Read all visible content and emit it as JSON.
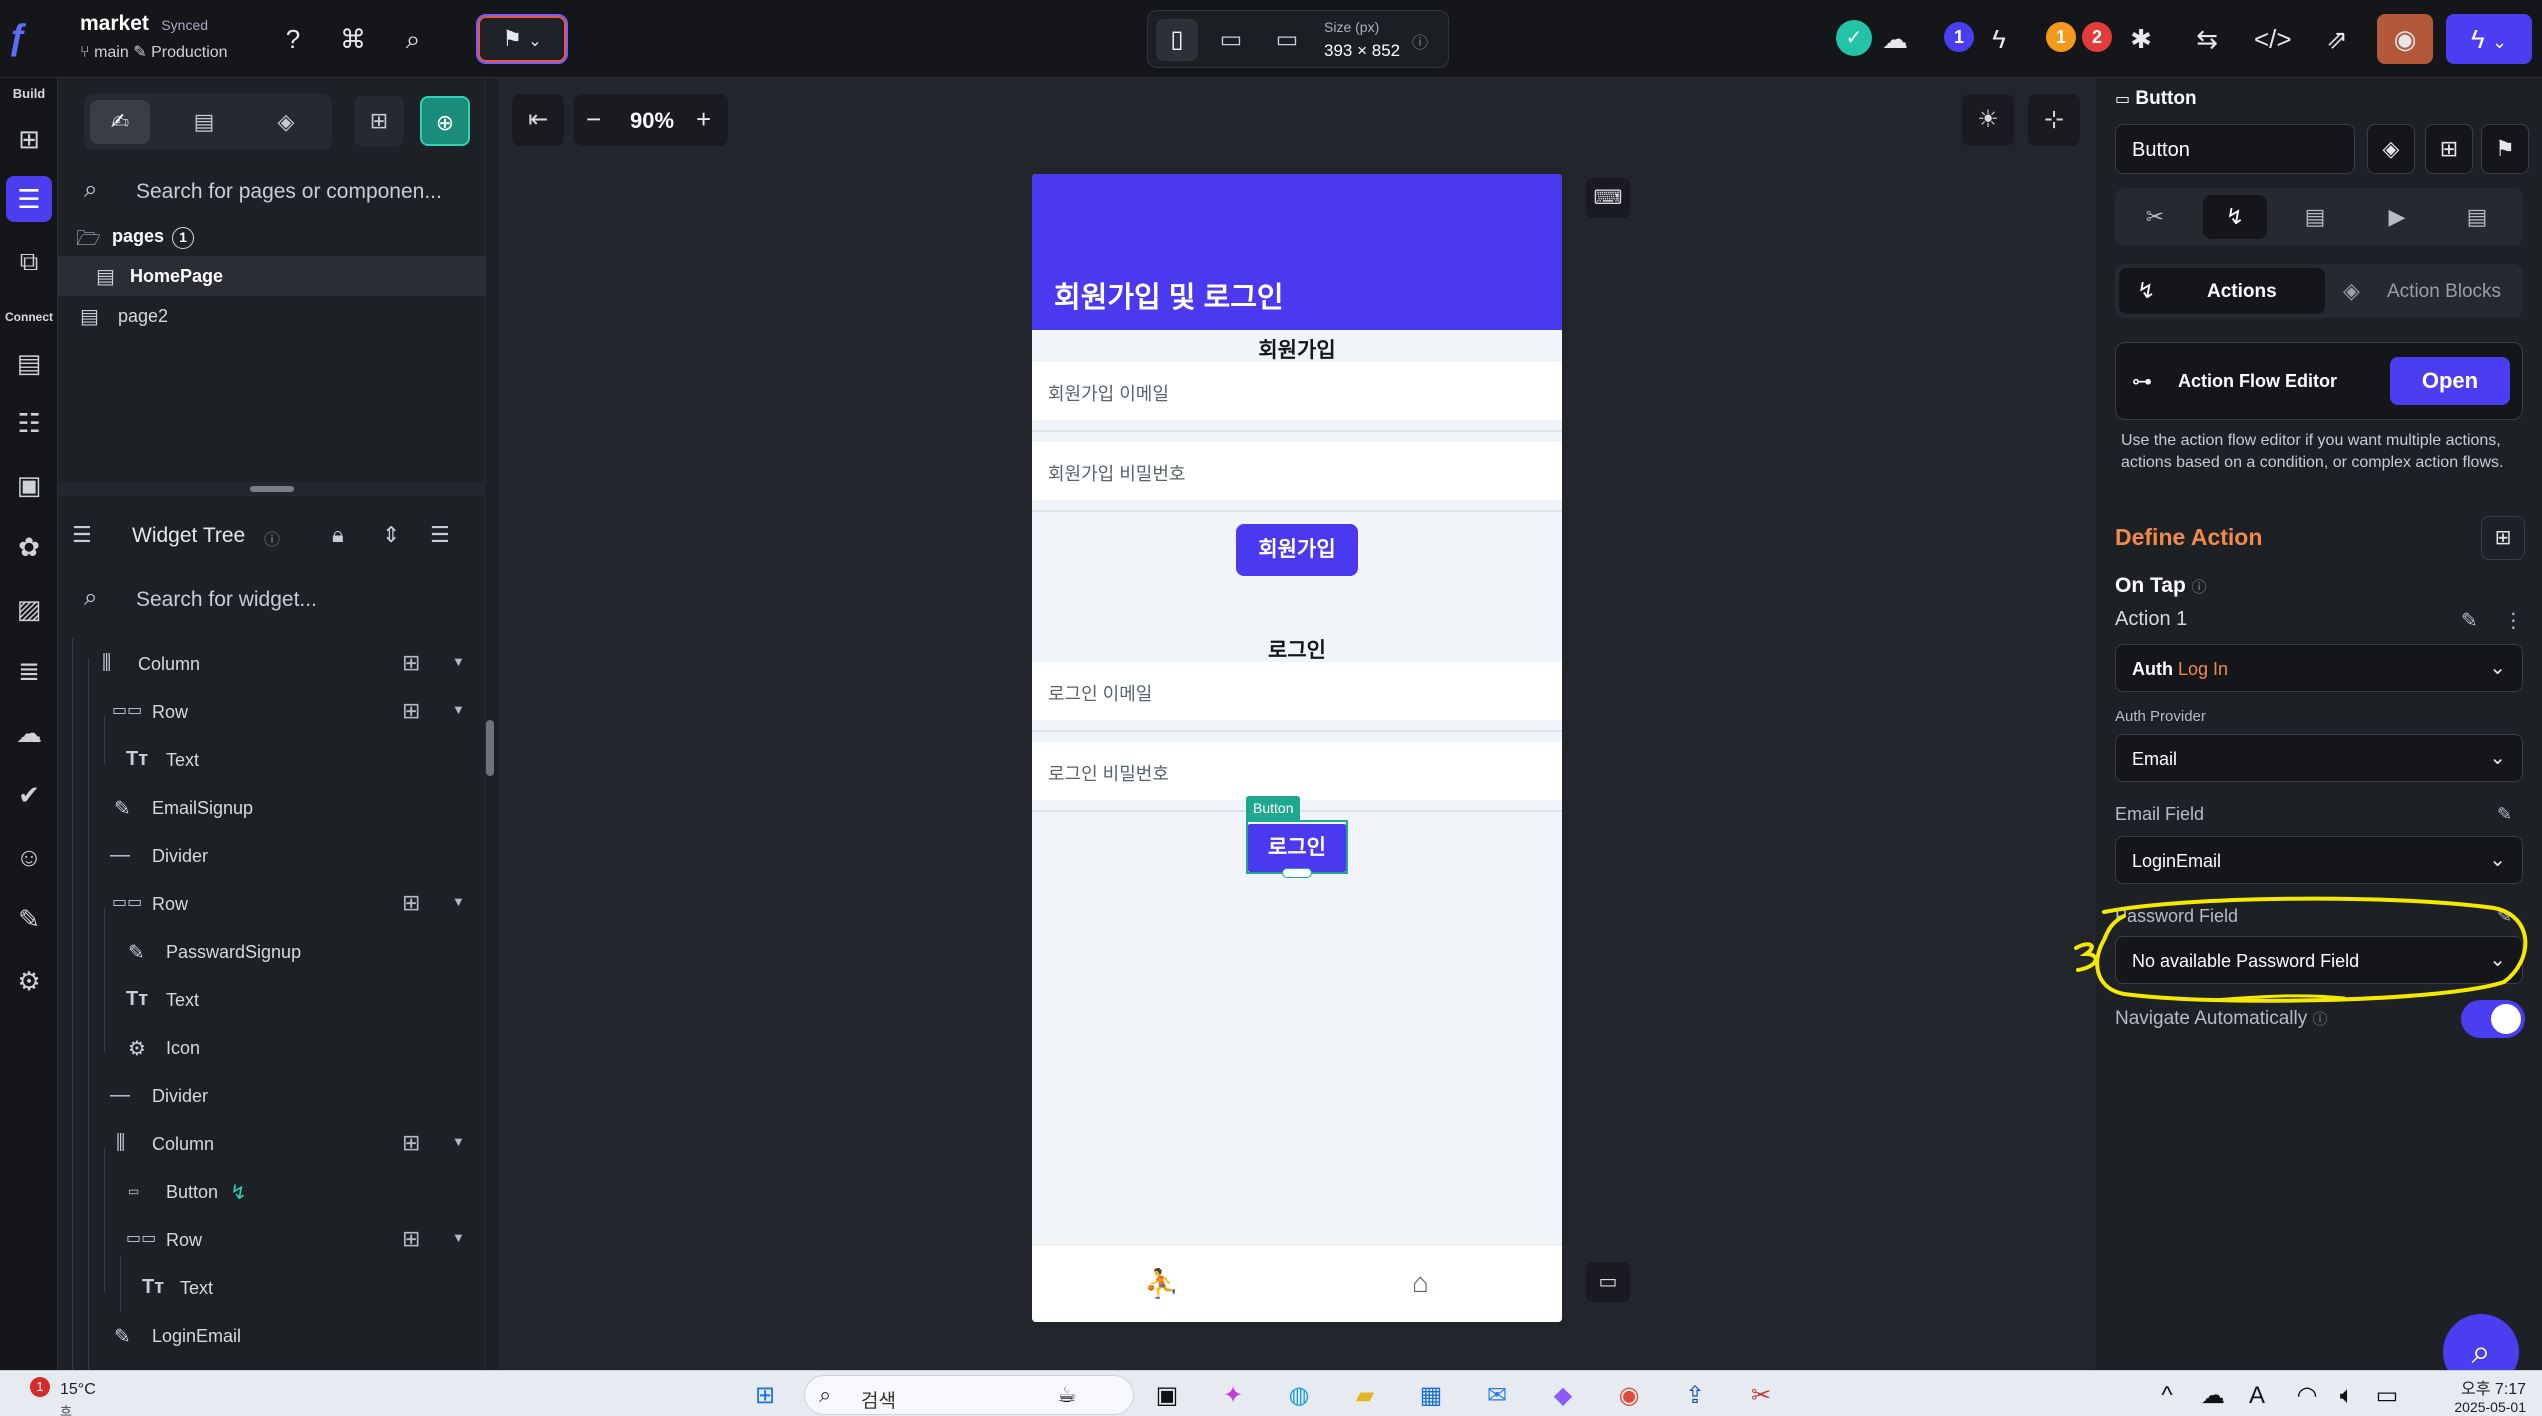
{
  "topbar": {
    "project_name": "market",
    "sync_status": "Synced",
    "branch": "main",
    "environment": "Production",
    "size_label": "Size (px)",
    "size_value": "393 × 852",
    "badge_blue": "1",
    "badge_orange": "1",
    "badge_red": "2"
  },
  "rail": {
    "build_label": "Build",
    "connect_label": "Connect"
  },
  "left_panel": {
    "search_placeholder": "Search for pages or componen...",
    "pages_label": "pages",
    "pages_count": "1",
    "pages": [
      "HomePage",
      "page2"
    ],
    "widget_tree_title": "Widget Tree",
    "widget_search_placeholder": "Search for widget...",
    "widgets": [
      "Column",
      "Row",
      "Text",
      "EmailSignup",
      "Divider",
      "Row",
      "PasswardSignup",
      "Text",
      "Icon",
      "Divider",
      "Column",
      "Button",
      "Row",
      "Text",
      "LoginEmail"
    ]
  },
  "canvas": {
    "zoom": "90%"
  },
  "phone": {
    "appbar_title": "회원가입 및 로그인",
    "signup_title": "회원가입",
    "signup_email": "회원가입 이메일",
    "signup_password": "회원가입 비밀번호",
    "signup_button": "회원가입",
    "login_title": "로그인",
    "login_email": "로그인 이메일",
    "login_password": "로그인 비밀번호",
    "login_button": "로그인",
    "selected_tag": "Button"
  },
  "right_panel": {
    "widget_type": "Button",
    "widget_name": "Button",
    "tab_actions": "Actions",
    "tab_action_blocks": "Action Blocks",
    "action_flow_editor": "Action Flow Editor",
    "open_button": "Open",
    "afe_description": "Use the action flow editor if you want multiple actions, actions based on a condition, or complex action flows.",
    "define_action": "Define Action",
    "on_tap": "On Tap",
    "action_1": "Action 1",
    "action_type_bold": "Auth",
    "action_type": "Log In",
    "auth_provider_label": "Auth Provider",
    "auth_provider": "Email",
    "email_field_label": "Email Field",
    "email_field": "LoginEmail",
    "password_field_label": "Password Field",
    "password_field": "No available Password Field",
    "navigate_auto": "Navigate Automatically"
  },
  "taskbar": {
    "temperature": "15°C",
    "weather_sub": "흐림",
    "weather_badge": "1",
    "search_text": "검색",
    "time": "오후 7:17",
    "date": "2025-05-01"
  },
  "colors": {
    "primary": "#4b39ef",
    "accent_orange": "#f08a4b",
    "selection_teal": "#1fa88f",
    "annotation_yellow": "#f5e900"
  }
}
